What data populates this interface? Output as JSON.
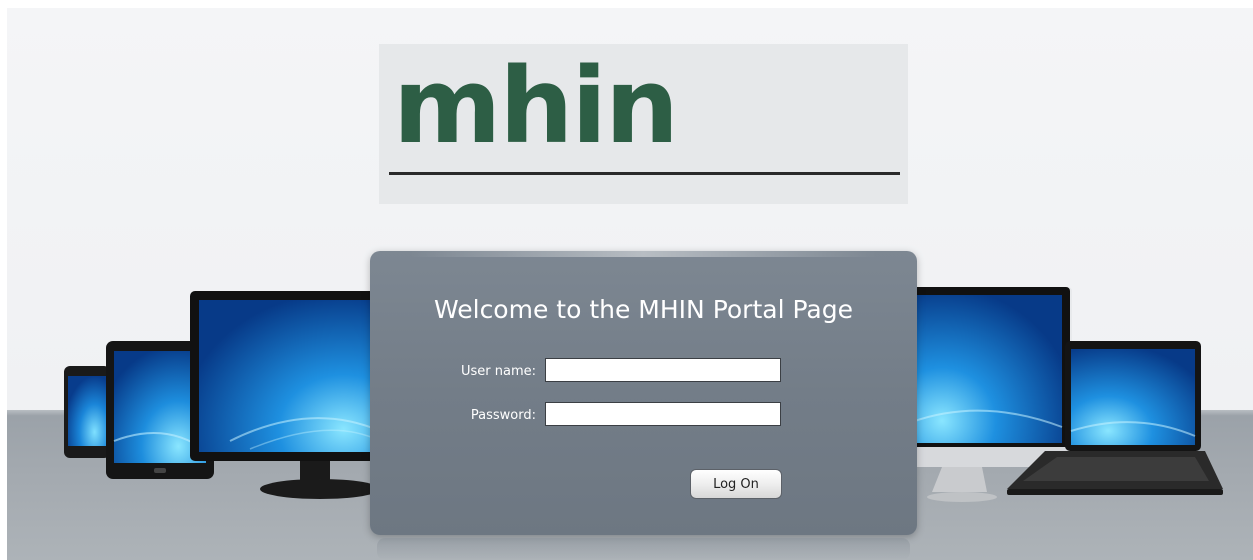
{
  "logo": {
    "text": "mhin"
  },
  "panel": {
    "title": "Welcome to the MHIN Portal Page",
    "username_label": "User name:",
    "username_value": "",
    "password_label": "Password:",
    "password_value": "",
    "logon_label": "Log On"
  },
  "colors": {
    "logo_green": "#2d5e45",
    "panel_bg": "#737d88",
    "floor": "#a3a9af"
  },
  "devices": [
    "phone-icon",
    "tablet-icon",
    "monitor-icon",
    "all-in-one-icon",
    "laptop-icon"
  ]
}
